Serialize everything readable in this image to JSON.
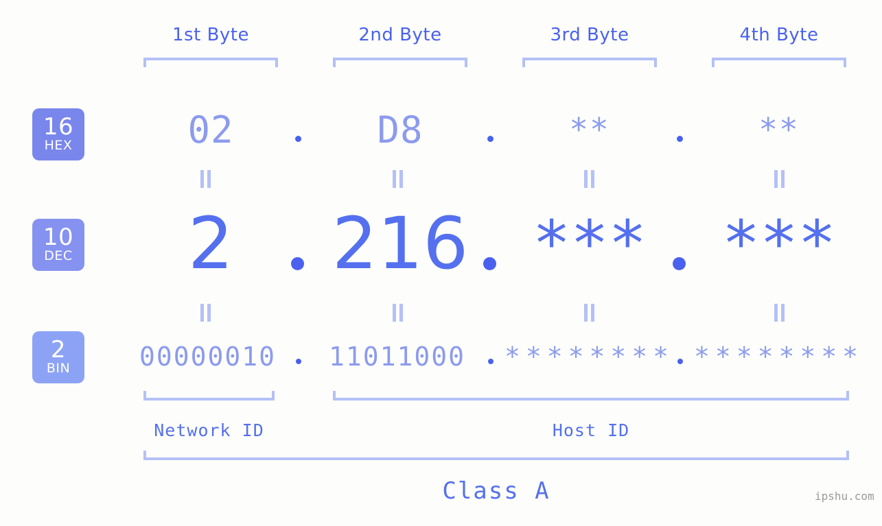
{
  "background_color": "#fdfefb",
  "accent_colors": {
    "strong_blue": "#4a61ef",
    "dec_blue": "#5570ee",
    "light_blue": "#8c9bee",
    "bracket_blue": "#b4c0f7",
    "badge_hex": "#7986ec",
    "badge_dec": "#8692f0",
    "badge_bin": "#8ca3f5",
    "watermark_grey": "#9a9a9a"
  },
  "headers": {
    "byte1": "1st Byte",
    "byte2": "2nd Byte",
    "byte3": "3rd Byte",
    "byte4": "4th Byte"
  },
  "bases": [
    {
      "number": "16",
      "label": "HEX"
    },
    {
      "number": "10",
      "label": "DEC"
    },
    {
      "number": "2",
      "label": "BIN"
    }
  ],
  "rows": {
    "hex": {
      "base_number": "16",
      "base_label": "HEX",
      "values": [
        "02",
        "D8",
        "**",
        "**"
      ],
      "separator": "."
    },
    "dec": {
      "base_number": "10",
      "base_label": "DEC",
      "values": [
        "2",
        "216",
        "***",
        "***"
      ],
      "separator": "."
    },
    "bin": {
      "base_number": "2",
      "base_label": "BIN",
      "values": [
        "00000010",
        "11011000",
        "********",
        "********"
      ],
      "separator": "."
    }
  },
  "equals_mark": "=",
  "segments": {
    "network_id": "Network ID",
    "host_id": "Host ID"
  },
  "class_label": "Class A",
  "watermark": "ipshu.com"
}
